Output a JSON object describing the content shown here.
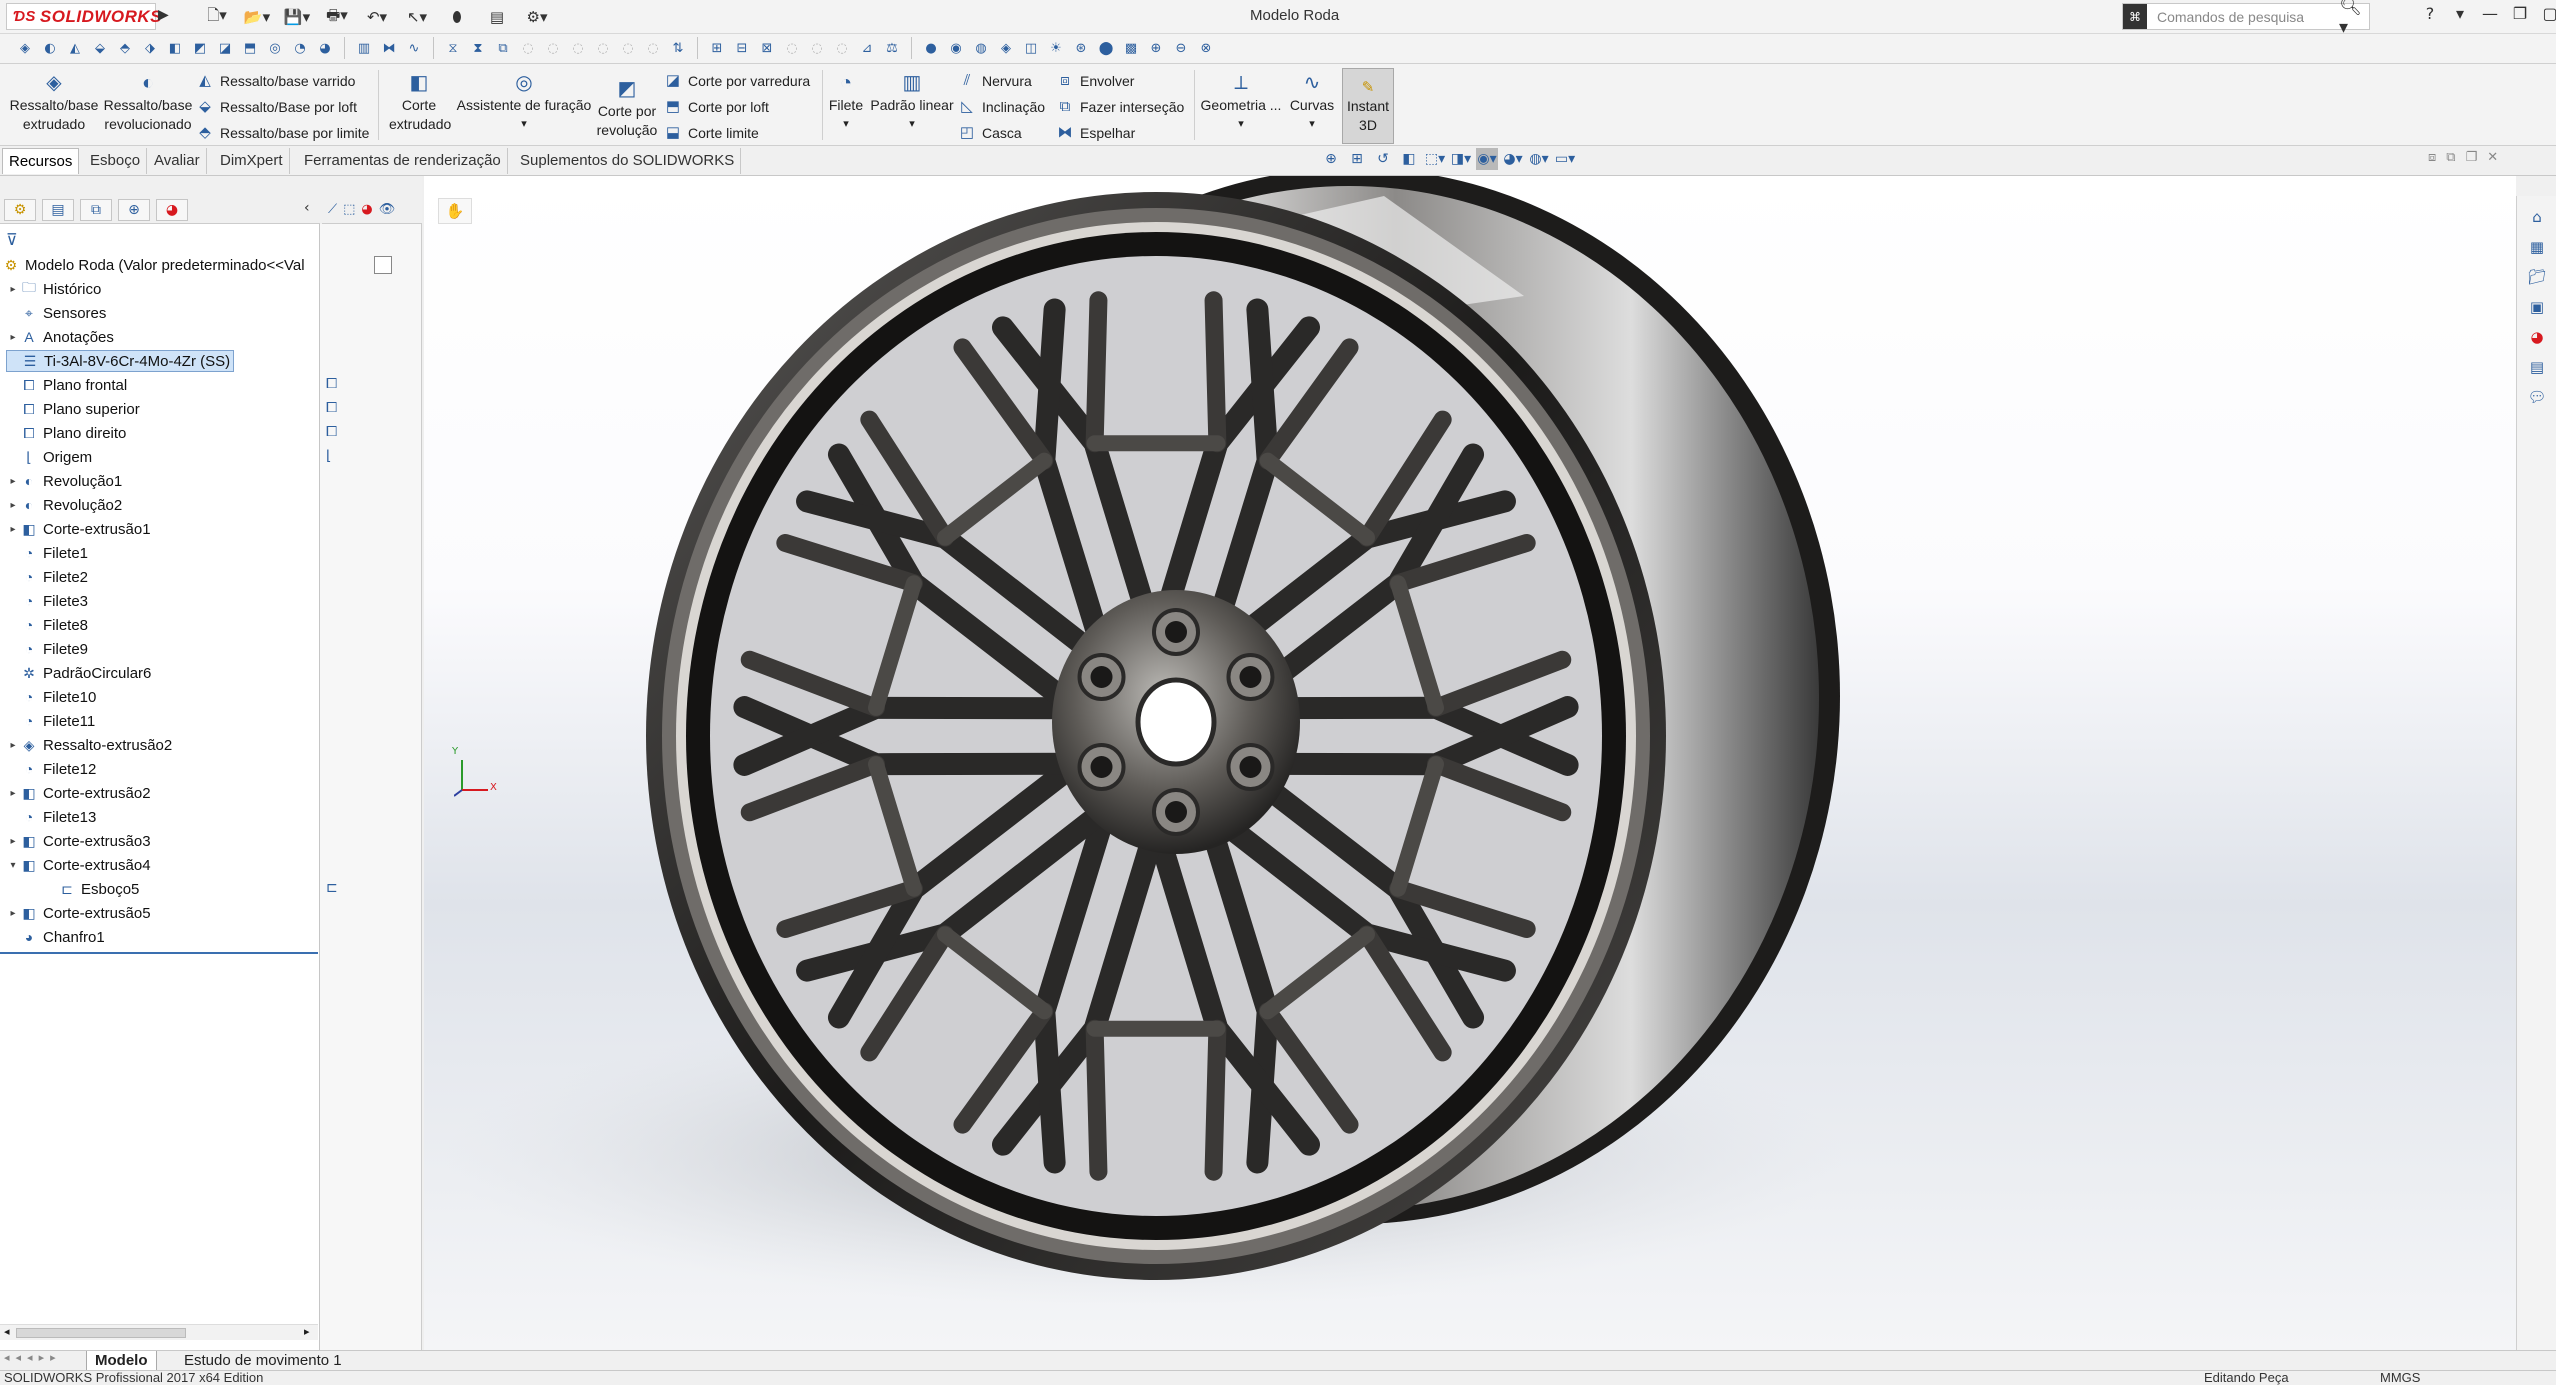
{
  "app": {
    "brand": "SOLIDWORKS",
    "document_title": "Modelo Roda",
    "search_placeholder": "Comandos de pesquisa",
    "help": "?"
  },
  "commands": {
    "extruded_boss": "Ressalto/base extrudado",
    "revolved_boss": "Ressalto/base revolucionado",
    "swept_boss": "Ressalto/base varrido",
    "loft_boss": "Ressalto/Base por loft",
    "boundary_boss": "Ressalto/base por limite",
    "extruded_cut": "Corte extrudado",
    "hole_wizard": "Assistente de furação",
    "revolved_cut": "Corte por revolução",
    "swept_cut": "Corte por varredura",
    "loft_cut": "Corte por loft",
    "boundary_cut": "Corte limite",
    "fillet": "Filete",
    "linear_pattern": "Padrão linear",
    "rib": "Nervura",
    "draft": "Inclinação",
    "shell": "Casca",
    "wrap": "Envolver",
    "intersect": "Fazer interseção",
    "mirror": "Espelhar",
    "ref_geometry": "Geometria ...",
    "curves": "Curvas",
    "instant3d": "Instant 3D"
  },
  "tabs": [
    "Recursos",
    "Esboço",
    "Avaliar",
    "DimXpert",
    "Ferramentas de renderização",
    "Suplementos do SOLIDWORKS"
  ],
  "tree": {
    "root": "Modelo Roda  (Valor predeterminado<<Val",
    "items": [
      {
        "label": "Histórico",
        "icon": "history-folder-icon"
      },
      {
        "label": "Sensores",
        "icon": "sensor-icon"
      },
      {
        "label": "Anotações",
        "icon": "annotations-icon"
      },
      {
        "label": "Ti-3Al-8V-6Cr-4Mo-4Zr (SS)",
        "icon": "material-icon"
      },
      {
        "label": "Plano frontal",
        "icon": "plane-icon"
      },
      {
        "label": "Plano superior",
        "icon": "plane-icon"
      },
      {
        "label": "Plano direito",
        "icon": "plane-icon"
      },
      {
        "label": "Origem",
        "icon": "origin-icon"
      },
      {
        "label": "Revolução1",
        "icon": "revolve-icon"
      },
      {
        "label": "Revolução2",
        "icon": "revolve-icon"
      },
      {
        "label": "Corte-extrusão1",
        "icon": "cut-extrude-icon"
      },
      {
        "label": "Filete1",
        "icon": "fillet-icon"
      },
      {
        "label": "Filete2",
        "icon": "fillet-icon"
      },
      {
        "label": "Filete3",
        "icon": "fillet-icon"
      },
      {
        "label": "Filete8",
        "icon": "fillet-icon"
      },
      {
        "label": "Filete9",
        "icon": "fillet-icon"
      },
      {
        "label": "PadrãoCircular6",
        "icon": "circular-pattern-icon"
      },
      {
        "label": "Filete10",
        "icon": "fillet-icon"
      },
      {
        "label": "Filete11",
        "icon": "fillet-icon"
      },
      {
        "label": "Ressalto-extrusão2",
        "icon": "boss-extrude-icon"
      },
      {
        "label": "Filete12",
        "icon": "fillet-icon"
      },
      {
        "label": "Corte-extrusão2",
        "icon": "cut-extrude-icon"
      },
      {
        "label": "Filete13",
        "icon": "fillet-icon"
      },
      {
        "label": "Corte-extrusão3",
        "icon": "cut-extrude-icon"
      },
      {
        "label": "Corte-extrusão4",
        "icon": "cut-extrude-icon"
      },
      {
        "label": "Esboço5",
        "icon": "sketch-icon"
      },
      {
        "label": "Corte-extrusão5",
        "icon": "cut-extrude-icon"
      },
      {
        "label": "Chanfro1",
        "icon": "chamfer-icon"
      }
    ]
  },
  "bottom_tabs": {
    "model": "Modelo",
    "motion": "Estudo de movimento 1"
  },
  "status": {
    "edition": "SOLIDWORKS Profissional 2017 x64 Edition",
    "editing": "Editando Peça",
    "units": "MMGS"
  },
  "triad": {
    "x": "X",
    "y": "Y"
  }
}
